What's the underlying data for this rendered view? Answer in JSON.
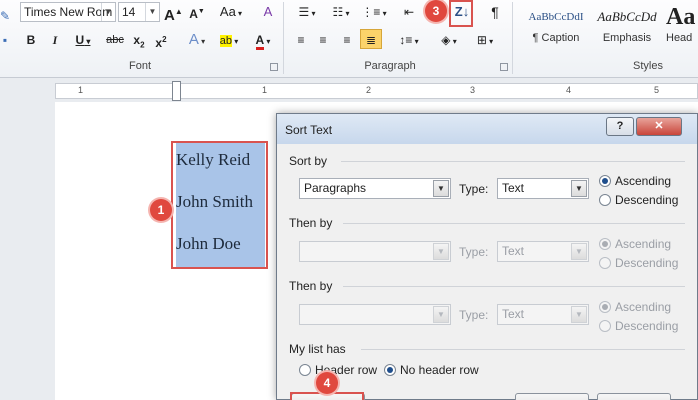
{
  "ribbon": {
    "font": {
      "font_name": "Times New Rom",
      "font_size": "14",
      "grow_font": "A",
      "shrink_font": "A",
      "change_case": "Aa",
      "clear_format": "A",
      "bold": "B",
      "italic": "I",
      "underline": "U",
      "strikethrough": "abc",
      "subscript": "x",
      "subscript_mark": "2",
      "superscript": "x",
      "superscript_mark": "2",
      "text_effects": "A",
      "highlight": "ab",
      "font_color": "A",
      "group_label": "Font"
    },
    "paragraph": {
      "pilcrow": "¶",
      "group_label": "Paragraph"
    },
    "styles": {
      "items": [
        {
          "preview": "AaBbCcDdI",
          "name": "¶ Caption"
        },
        {
          "preview": "AaBbCcDd",
          "name": "Emphasis"
        },
        {
          "preview": "Aa",
          "name": "Head"
        }
      ],
      "group_label": "Styles"
    }
  },
  "ruler": {
    "numbers": [
      "1",
      "1",
      "2",
      "3",
      "4",
      "5"
    ]
  },
  "document": {
    "lines": [
      "Kelly Reid",
      "John Smith",
      "John Doe"
    ]
  },
  "badges": [
    "1",
    "3",
    "4"
  ],
  "dialog": {
    "title": "Sort Text",
    "help_label": "?",
    "close_label": "✕",
    "sort_by": {
      "title": "Sort by",
      "field": "Paragraphs",
      "type_label": "Type:",
      "type_value": "Text",
      "ascending": "Ascending",
      "descending": "Descending"
    },
    "then_by_1": {
      "title": "Then by",
      "field": "",
      "type_label": "Type:",
      "type_value": "Text",
      "ascending": "Ascending",
      "descending": "Descending"
    },
    "then_by_2": {
      "title": "Then by",
      "field": "",
      "type_label": "Type:",
      "type_value": "Text",
      "ascending": "Ascending",
      "descending": "Descending"
    },
    "list_has": {
      "title": "My list has",
      "header_row": "Header row",
      "no_header_row": "No header row"
    }
  },
  "colors": {
    "selection": "#a9c4e8",
    "annotation_red": "#e0483e",
    "dialog_bg": "#f0f0f0",
    "close_button": "#c9453a"
  }
}
